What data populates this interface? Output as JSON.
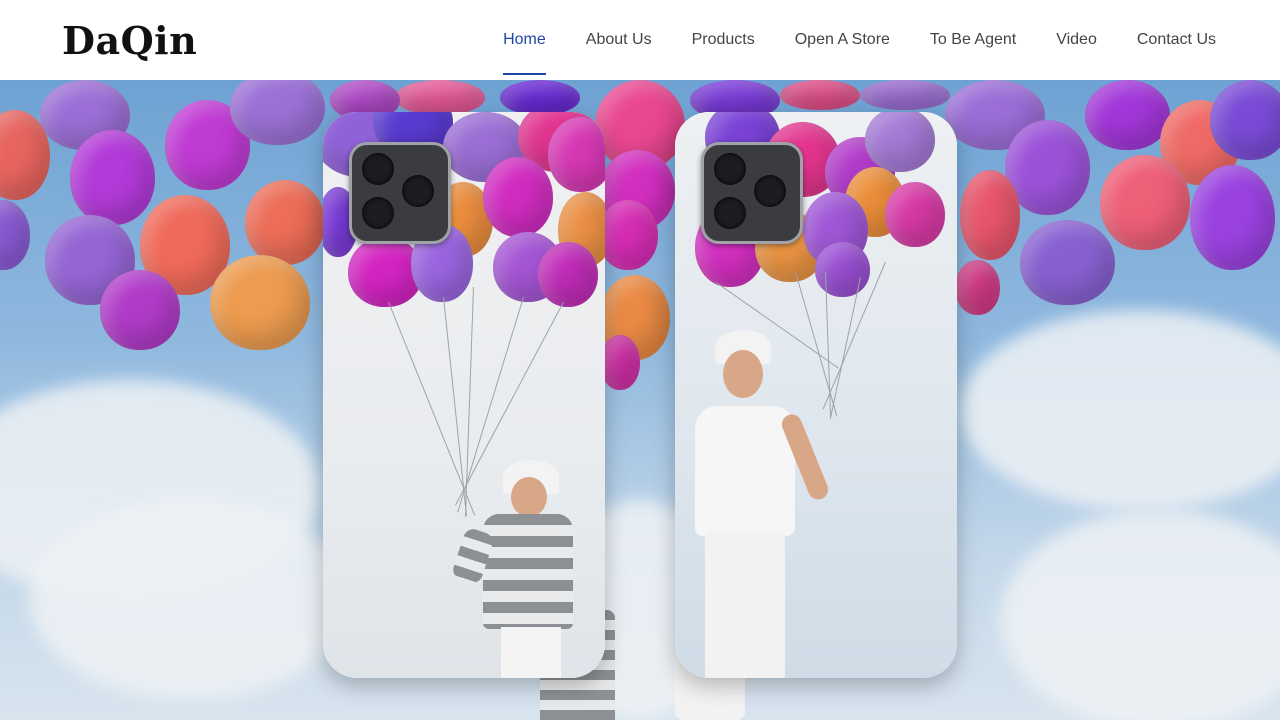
{
  "brand": {
    "logo_text": "DaQin"
  },
  "nav": {
    "items": [
      {
        "label": "Home",
        "active": true
      },
      {
        "label": "About Us",
        "active": false
      },
      {
        "label": "Products",
        "active": false
      },
      {
        "label": "Open A Store",
        "active": false
      },
      {
        "label": "To Be Agent",
        "active": false
      },
      {
        "label": "Video",
        "active": false
      },
      {
        "label": "Contact Us",
        "active": false
      }
    ]
  },
  "colors": {
    "accent": "#1f47a8",
    "nav_text": "#444444",
    "sky": "#7aaad8"
  },
  "hero": {
    "image_subject": "phone-cases-balloons-banner"
  }
}
